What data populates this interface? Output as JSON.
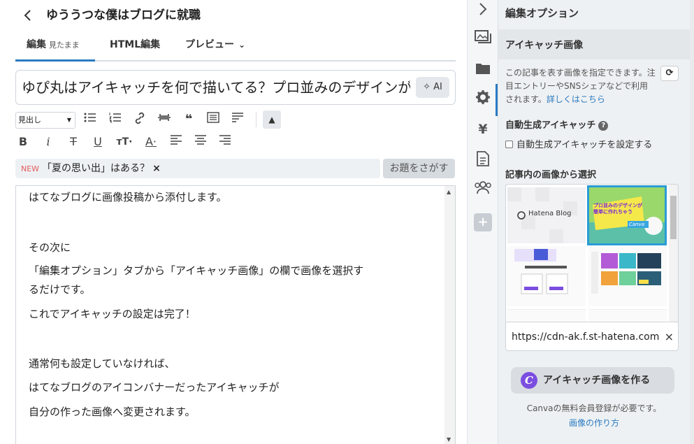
{
  "header": {
    "blog_name": "ゆううつな僕はブログに就職"
  },
  "tabs": {
    "edit_label": "編集",
    "edit_sub": "見たまま",
    "html_label": "HTML編集",
    "preview_label": "プレビュー"
  },
  "title_field": {
    "value": "ゆぴ丸はアイキャッチを何で描いてる？プロ並みのデザインが",
    "ai_label": "AI"
  },
  "toolbar": {
    "heading_select": "見出し"
  },
  "topic": {
    "new_badge": "NEW",
    "text": "「夏の思い出」はある？",
    "close": "×",
    "search_button": "お題をさがす"
  },
  "body": {
    "lines": [
      "はてなブログに画像投稿から添付します。",
      "その次に",
      "「編集オプション」タブから「アイキャッチ画像」の欄で画像を選択す",
      "るだけです。",
      "これでアイキャッチの設定は完了！",
      "通常何も設定していなければ、",
      "はてなブログのアイコンバナーだったアイキャッチが",
      "自分の作った画像へ変更されます。"
    ]
  },
  "panel": {
    "title": "編集オプション",
    "section_title": "アイキャッチ画像",
    "description": "この記事を表す画像を指定できます。注目エントリーやSNSシェアなどで利用されます。",
    "details_link": "詳しくはこちら",
    "auto_title": "自動生成アイキャッチ",
    "auto_checkbox_label": "自動生成アイキャッチを設定する",
    "select_title": "記事内の画像から選択",
    "hatena_logo_text": "Hatena Blog",
    "featured_image_caption": "プロ並みのデザインが簡単に作れちゃう",
    "featured_image_brand": "Canva",
    "url_value": "https://cdn-ak.f.st-hatena.com",
    "url_clear": "×",
    "canva_button": "アイキャッチ画像を作る",
    "canva_logo": "C",
    "note": "Canvaの無料会員登録が必要です。",
    "howto_link": "画像の作り方"
  },
  "colors": {
    "accent": "#2a7ac2",
    "panel_bg": "#eef1f3",
    "new_badge": "#e35b5b"
  },
  "icons": {
    "back": "chevron-left",
    "rail": [
      "chevron-right",
      "image",
      "folder",
      "gear",
      "yen",
      "document",
      "users",
      "plus"
    ]
  }
}
